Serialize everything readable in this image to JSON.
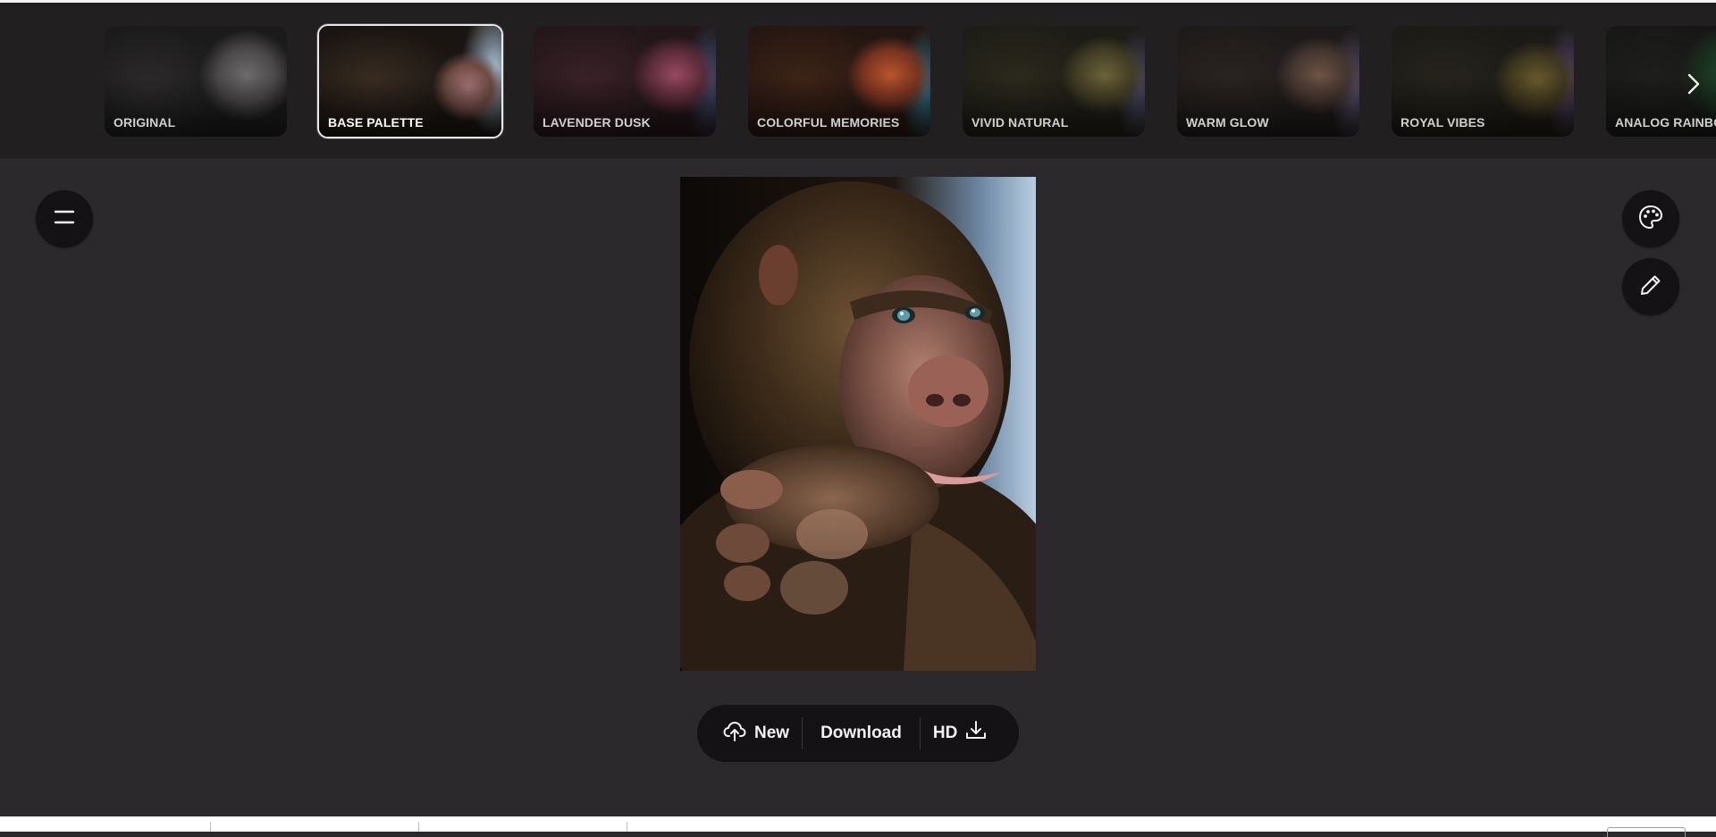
{
  "palettes": [
    {
      "label": "ORIGINAL",
      "selected": false
    },
    {
      "label": "BASE PALETTE",
      "selected": true
    },
    {
      "label": "LAVENDER DUSK",
      "selected": false
    },
    {
      "label": "COLORFUL MEMORIES",
      "selected": false
    },
    {
      "label": "VIVID NATURAL",
      "selected": false
    },
    {
      "label": "WARM GLOW",
      "selected": false
    },
    {
      "label": "ROYAL VIBES",
      "selected": false
    },
    {
      "label": "ANALOG RAINBOW",
      "selected": false
    }
  ],
  "icons": {
    "menu": "hamburger-menu-icon",
    "palette": "palette-icon",
    "edit": "pencil-icon",
    "next": "chevron-right-icon",
    "upload": "cloud-upload-icon",
    "download": "download-icon"
  },
  "actions": {
    "new_label": "New",
    "download_label": "Download",
    "hd_label": "HD"
  },
  "colors": {
    "background": "#2b292b",
    "strip": "#221f21",
    "button_bg": "#141214",
    "selected_border": "#e8e8e8"
  }
}
